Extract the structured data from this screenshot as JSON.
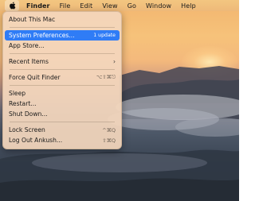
{
  "menubar": {
    "items": [
      "Finder",
      "File",
      "Edit",
      "View",
      "Go",
      "Window",
      "Help"
    ]
  },
  "apple_menu": {
    "about": "About This Mac",
    "system_preferences": "System Preferences...",
    "update_badge": "1 update",
    "app_store": "App Store...",
    "recent_items": "Recent Items",
    "force_quit": "Force Quit Finder",
    "force_quit_shortcut": "⌥⇧⌘⎋",
    "sleep": "Sleep",
    "restart": "Restart...",
    "shut_down": "Shut Down...",
    "lock_screen": "Lock Screen",
    "lock_screen_shortcut": "^⌘Q",
    "log_out": "Log Out Ankush...",
    "log_out_shortcut": "⇧⌘Q"
  },
  "colors": {
    "highlight": "#2f7cf6",
    "menu_background": "#f3d6bc"
  }
}
